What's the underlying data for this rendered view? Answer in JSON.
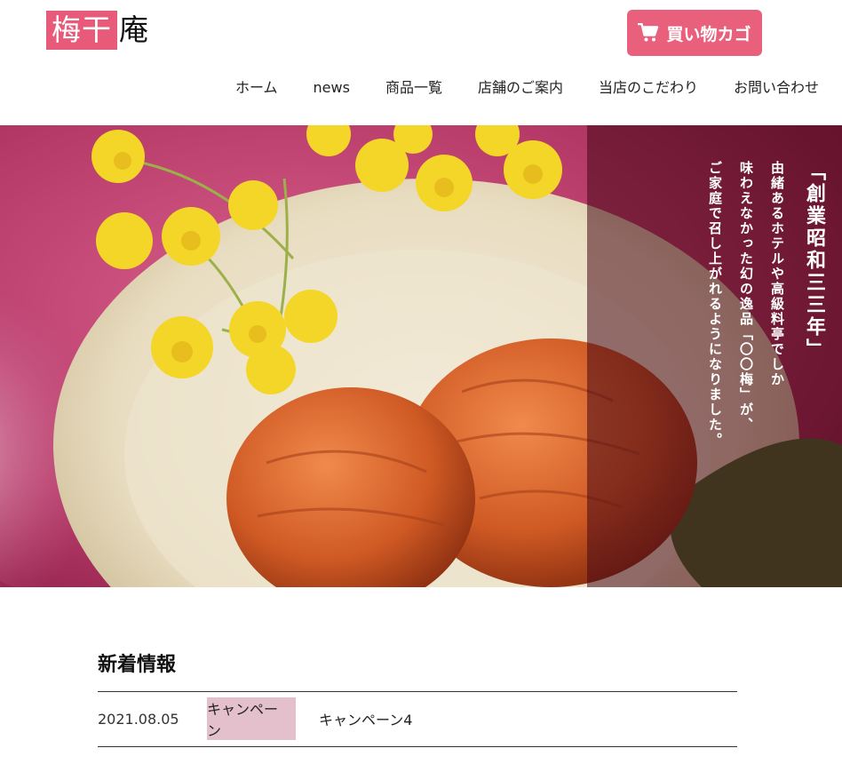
{
  "header": {
    "logo_highlight": "梅干",
    "logo_rest": "庵",
    "cart_label": "買い物カゴ",
    "cart_icon": "cart-icon"
  },
  "nav": {
    "items": [
      {
        "label": "ホーム"
      },
      {
        "label": "news"
      },
      {
        "label": "商品一覧"
      },
      {
        "label": "店舗のご案内"
      },
      {
        "label": "当店のこだわり"
      },
      {
        "label": "お問い合わせ"
      }
    ]
  },
  "hero": {
    "title": "「創業昭和三三年」",
    "lines": [
      "由緒あるホテルや高級料亭でしか",
      "味わえなかった幻の逸品「〇〇梅」が、",
      "ご家庭で召し上がれるようになりました。"
    ]
  },
  "news": {
    "heading": "新着情報",
    "items": [
      {
        "date": "2021.08.05",
        "category": "キャンペーン",
        "text": "キャンペーン4"
      }
    ]
  },
  "colors": {
    "accent": "#e8607c",
    "logo_bg": "#e85a7a",
    "category_bg": "#e4c0cc"
  }
}
